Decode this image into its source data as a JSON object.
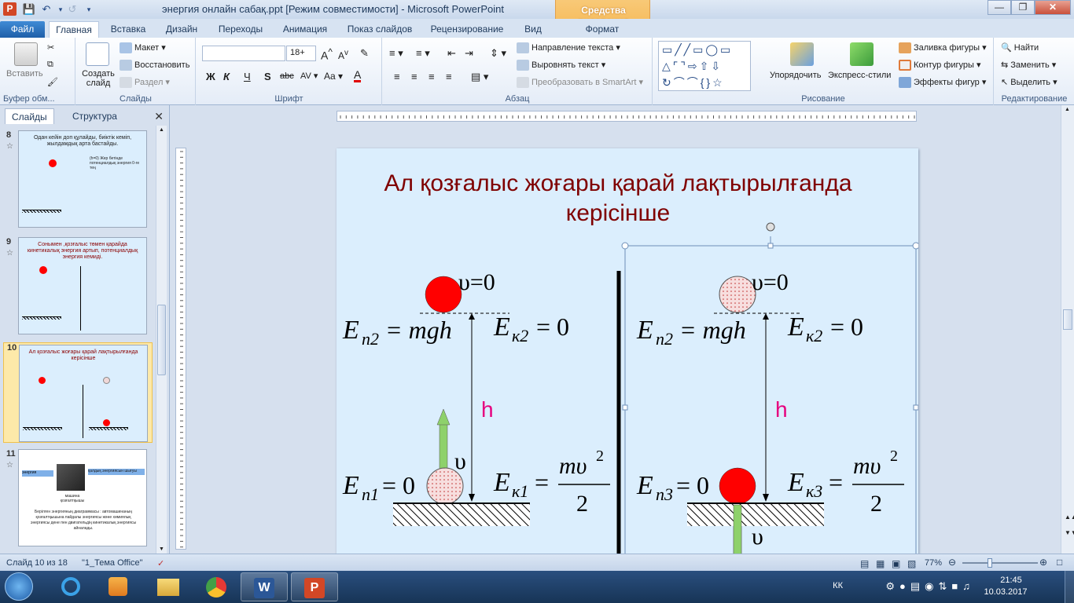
{
  "window": {
    "title": "энергия онлайн сабақ.ppt [Режим совместимости]  -  Microsoft PowerPoint",
    "contextual_tab_group": "Средства рисования"
  },
  "tabs": [
    {
      "label": "Файл"
    },
    {
      "label": "Главная"
    },
    {
      "label": "Вставка"
    },
    {
      "label": "Дизайн"
    },
    {
      "label": "Переходы"
    },
    {
      "label": "Анимация"
    },
    {
      "label": "Показ слайдов"
    },
    {
      "label": "Рецензирование"
    },
    {
      "label": "Вид"
    },
    {
      "label": "Формат"
    }
  ],
  "ribbon": {
    "clipboard": {
      "name": "Буфер обм...",
      "paste": "Вставить"
    },
    "slides": {
      "name": "Слайды",
      "new_slide": "Создать слайд",
      "layout": "Макет",
      "reset": "Восстановить",
      "section": "Раздел"
    },
    "font": {
      "name": "Шрифт",
      "font_name": "",
      "font_size": "18+"
    },
    "paragraph": {
      "name": "Абзац",
      "text_direction": "Направление текста",
      "align_text": "Выровнять текст",
      "smartart": "Преобразовать в SmartArt"
    },
    "drawing": {
      "name": "Рисование",
      "arrange": "Упорядочить",
      "quick_styles": "Экспресс-стили",
      "shape_fill": "Заливка фигуры",
      "shape_outline": "Контур фигуры",
      "shape_effects": "Эффекты фигур"
    },
    "editing": {
      "name": "Редактирование",
      "find": "Найти",
      "replace": "Заменить",
      "select": "Выделить"
    }
  },
  "left_panel": {
    "tabs": [
      "Слайды",
      "Структура"
    ],
    "thumbnails": [
      {
        "number": "8",
        "caption": "Одан кейін доп құлайды, биіктік кеміп, жылдамдық арта бастайды.",
        "note": "(h=0) Жер бетінде потенциалдық энергия 0-ге тең"
      },
      {
        "number": "9",
        "caption": "Сонымен ,қозғалыс төмен қарайда кинетикалық энергия артып, потенциалдық энергия кемиді."
      },
      {
        "number": "10",
        "caption": "Ал қозғалыс жоғары қарай  лақтырылғанда керісінше"
      },
      {
        "number": "11",
        "label_left": "энергия",
        "label_right": "қалдық энергиясын шығуы",
        "label_under": "машина қозғалтқышы",
        "body": "Берілген энергияның диаграммасы : автомашинаның қозғалтқышына пайдалы энергиясы және химиялық энергиясы дене пен двигательдің кинетикалық энергиясы айналады."
      }
    ]
  },
  "slide": {
    "title_line1": "Ал қозғалыс жоғары қарай  лақтырылғанда",
    "title_line2": "керісінше",
    "title_color": "#7f0000",
    "h_label": "h",
    "h_color": "#e6007e",
    "left": {
      "v_top": "υ=0",
      "ep_top": "E",
      "ep_top_sub": "п2",
      "ep_top_rhs": "= mgh",
      "ek_top": "E",
      "ek_top_sub": "к2",
      "ek_top_rhs": "= 0",
      "ep_bot": "E",
      "ep_bot_sub": "п1",
      "ep_bot_rhs": "= 0",
      "ek_bot": "E",
      "ek_bot_sub": "к1",
      "ek_bot_eq": "=",
      "frac_num": "mυ",
      "frac_exp": "2",
      "frac_den": "2",
      "v_bot": "υ"
    },
    "right": {
      "v_top": "υ=0",
      "ep_top": "E",
      "ep_top_sub": "п2",
      "ep_top_rhs": "= mgh",
      "ek_top": "E",
      "ek_top_sub": "к2",
      "ek_top_rhs": "= 0",
      "ep_bot": "E",
      "ep_bot_sub": "п3",
      "ep_bot_rhs": "= 0",
      "ek_bot": "E",
      "ek_bot_sub": "к3",
      "ek_bot_eq": "=",
      "frac_num": "mυ",
      "frac_exp": "2",
      "frac_den": "2",
      "v_bot": "υ"
    }
  },
  "statusbar": {
    "slide_info": "Слайд 10 из 18",
    "theme": "\"1_Тема Office\"",
    "zoom": "77%"
  },
  "taskbar": {
    "lang": "КК",
    "time": "21:45",
    "date": "10.03.2017"
  },
  "colors": {
    "ball_red": "#ff0000",
    "arrow_green": "#8ed16b",
    "slide_bg": "#dbeefd"
  }
}
